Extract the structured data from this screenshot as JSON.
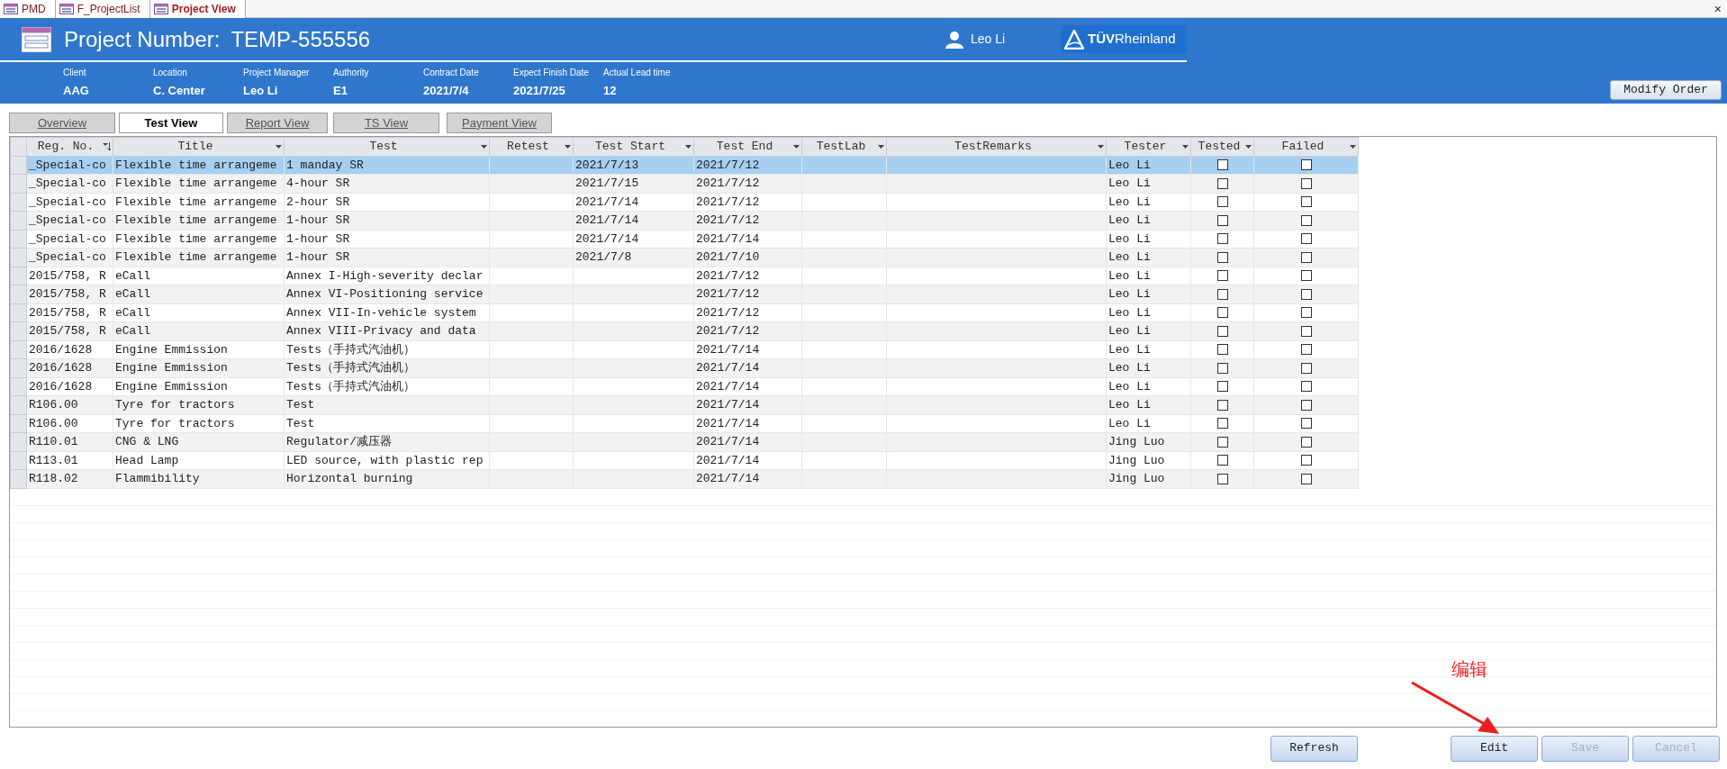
{
  "doc_tabs": [
    {
      "label": "PMD",
      "selected": false
    },
    {
      "label": "F_ProjectList",
      "selected": false
    },
    {
      "label": "Project View",
      "selected": true
    }
  ],
  "close_symbol": "×",
  "header": {
    "title_label": "Project Number:",
    "project_number": "TEMP-555556",
    "user": "Leo Li",
    "logo": "**TÜV**Rheinland",
    "fields": [
      {
        "label": "Client",
        "value": "AAG"
      },
      {
        "label": "Location",
        "value": "C. Center"
      },
      {
        "label": "Project Manager",
        "value": "Leo Li"
      },
      {
        "label": "Authority",
        "value": "E1"
      },
      {
        "label": "Contract Date",
        "value": "2021/7/4"
      },
      {
        "label": "Expect Finish Date",
        "value": "2021/7/25"
      },
      {
        "label": "Actual Lead time",
        "value": "12"
      }
    ],
    "modify_button": "Modify Order"
  },
  "view_tabs": [
    {
      "label": "Overview",
      "selected": false
    },
    {
      "label": "Test View",
      "selected": true
    },
    {
      "label": "Report View",
      "selected": false
    },
    {
      "label": "TS View",
      "selected": false
    },
    {
      "label": "Payment View",
      "selected": false
    }
  ],
  "table": {
    "columns": [
      {
        "label": "Reg. No.",
        "sorted": true
      },
      {
        "label": "Title",
        "sorted": false
      },
      {
        "label": "Test",
        "sorted": false
      },
      {
        "label": "Retest",
        "sorted": false
      },
      {
        "label": "Test Start",
        "sorted": false
      },
      {
        "label": "Test End",
        "sorted": false
      },
      {
        "label": "TestLab",
        "sorted": false
      },
      {
        "label": "TestRemarks",
        "sorted": false
      },
      {
        "label": "Tester",
        "sorted": false
      },
      {
        "label": "Tested",
        "sorted": false
      },
      {
        "label": "Failed",
        "sorted": false
      }
    ],
    "rows": [
      {
        "reg_no": "_Special-co",
        "title": "Flexible time arrangeme",
        "test": "1 manday SR",
        "test_start": "2021/7/13",
        "test_end": "2021/7/12",
        "tester": "Leo Li",
        "tested": false,
        "failed": false,
        "selected": true
      },
      {
        "reg_no": "_Special-co",
        "title": "Flexible time arrangeme",
        "test": "4-hour SR",
        "test_start": "2021/7/15",
        "test_end": "2021/7/12",
        "tester": "Leo Li",
        "tested": false,
        "failed": false,
        "selected": false
      },
      {
        "reg_no": "_Special-co",
        "title": "Flexible time arrangeme",
        "test": "2-hour SR",
        "test_start": "2021/7/14",
        "test_end": "2021/7/12",
        "tester": "Leo Li",
        "tested": false,
        "failed": false,
        "selected": false
      },
      {
        "reg_no": "_Special-co",
        "title": "Flexible time arrangeme",
        "test": "1-hour SR",
        "test_start": "2021/7/14",
        "test_end": "2021/7/12",
        "tester": "Leo Li",
        "tested": false,
        "failed": false,
        "selected": false
      },
      {
        "reg_no": "_Special-co",
        "title": "Flexible time arrangeme",
        "test": "1-hour SR",
        "test_start": "2021/7/14",
        "test_end": "2021/7/14",
        "tester": "Leo Li",
        "tested": false,
        "failed": false,
        "selected": false
      },
      {
        "reg_no": "_Special-co",
        "title": "Flexible time arrangeme",
        "test": "1-hour SR",
        "test_start": "2021/7/8",
        "test_end": "2021/7/10",
        "tester": "Leo Li",
        "tested": false,
        "failed": false,
        "selected": false
      },
      {
        "reg_no": "2015/758, R",
        "title": "eCall",
        "test": "Annex I-High-severity declar",
        "test_end": "2021/7/12",
        "tester": "Leo Li",
        "tested": false,
        "failed": false,
        "selected": false
      },
      {
        "reg_no": "2015/758, R",
        "title": "eCall",
        "test": "Annex VI-Positioning service",
        "test_end": "2021/7/12",
        "tester": "Leo Li",
        "tested": false,
        "failed": false,
        "selected": false
      },
      {
        "reg_no": "2015/758, R",
        "title": "eCall",
        "test": "Annex VII-In-vehicle system",
        "test_end": "2021/7/12",
        "tester": "Leo Li",
        "tested": false,
        "failed": false,
        "selected": false
      },
      {
        "reg_no": "2015/758, R",
        "title": "eCall",
        "test": "Annex VIII-Privacy and data",
        "test_end": "2021/7/12",
        "tester": "Leo Li",
        "tested": false,
        "failed": false,
        "selected": false
      },
      {
        "reg_no": "2016/1628",
        "title": "Engine Emmission",
        "test": "Tests（手持式汽油机）",
        "test_end": "2021/7/14",
        "tester": "Leo Li",
        "tested": false,
        "failed": false,
        "selected": false
      },
      {
        "reg_no": "2016/1628",
        "title": "Engine Emmission",
        "test": "Tests（手持式汽油机）",
        "test_end": "2021/7/14",
        "tester": "Leo Li",
        "tested": false,
        "failed": false,
        "selected": false
      },
      {
        "reg_no": "2016/1628",
        "title": "Engine Emmission",
        "test": "Tests（手持式汽油机）",
        "test_end": "2021/7/14",
        "tester": "Leo Li",
        "tested": false,
        "failed": false,
        "selected": false
      },
      {
        "reg_no": "R106.00",
        "title": "Tyre for tractors",
        "test": "Test",
        "test_end": "2021/7/14",
        "tester": "Leo Li",
        "tested": false,
        "failed": false,
        "selected": false
      },
      {
        "reg_no": "R106.00",
        "title": "Tyre for tractors",
        "test": "Test",
        "test_end": "2021/7/14",
        "tester": "Leo Li",
        "tested": false,
        "failed": false,
        "selected": false
      },
      {
        "reg_no": "R110.01",
        "title": "CNG & LNG",
        "test": "Regulator/减压器",
        "test_end": "2021/7/14",
        "tester": "Jing Luo",
        "tested": false,
        "failed": false,
        "selected": false
      },
      {
        "reg_no": "R113.01",
        "title": "Head Lamp",
        "test": "LED source, with plastic rep",
        "test_end": "2021/7/14",
        "tester": "Jing Luo",
        "tested": false,
        "failed": false,
        "selected": false
      },
      {
        "reg_no": "R118.02",
        "title": "Flammibility",
        "test": "Horizontal burning",
        "test_end": "2021/7/14",
        "tester": "Jing Luo",
        "tested": false,
        "failed": false,
        "selected": false
      }
    ]
  },
  "buttons": [
    {
      "label": "Refresh",
      "disabled": false
    },
    {
      "label": "Edit",
      "disabled": false
    },
    {
      "label": "Save",
      "disabled": true
    },
    {
      "label": "Cancel",
      "disabled": true
    }
  ],
  "annotation": {
    "text": "编辑"
  }
}
